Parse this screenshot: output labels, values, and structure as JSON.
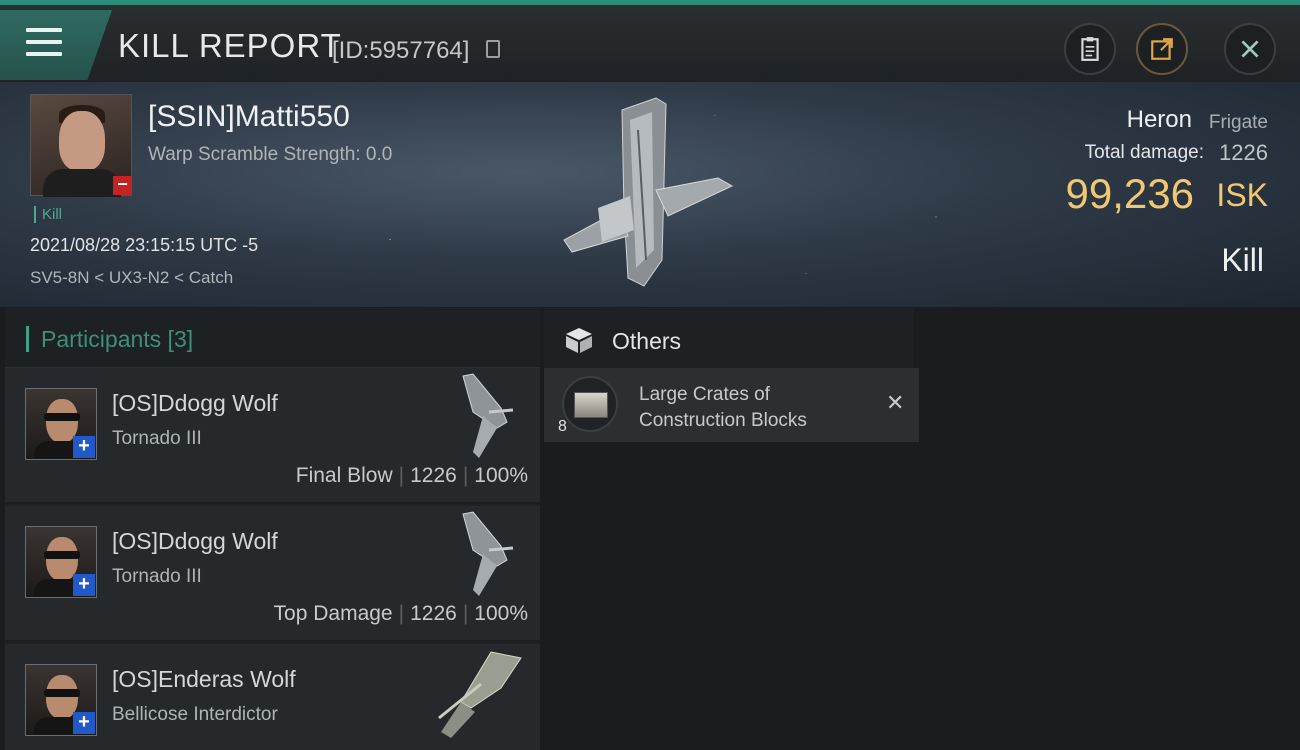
{
  "header": {
    "title": "KILL REPORT",
    "report_id": "[ID:5957764]",
    "icons": [
      "menu-icon",
      "copy-icon",
      "clipboard-icon",
      "share-icon",
      "close-icon"
    ]
  },
  "victim": {
    "name": "[SSIN]Matti550",
    "warp_scramble": "Warp Scramble Strength: 0.0",
    "tag": "Kill",
    "datetime": "2021/08/28 23:15:15 UTC -5",
    "location": "SV5-8N < UX3-N2 < Catch",
    "ship_name": "Heron",
    "ship_class": "Frigate",
    "total_damage_label": "Total damage:",
    "total_damage": "1226",
    "isk_value": "99,236",
    "isk_unit": "ISK",
    "result": "Kill"
  },
  "participants": {
    "title": "Participants [3]",
    "rows": [
      {
        "name": "[OS]Ddogg Wolf",
        "ship": "Tornado III",
        "role": "Final Blow",
        "damage": "1226",
        "percent": "100%"
      },
      {
        "name": "[OS]Ddogg Wolf",
        "ship": "Tornado III",
        "role": "Top Damage",
        "damage": "1226",
        "percent": "100%"
      },
      {
        "name": "[OS]Enderas Wolf",
        "ship": "Bellicose Interdictor",
        "role": "",
        "damage": "",
        "percent": ""
      }
    ]
  },
  "others": {
    "title": "Others",
    "items": [
      {
        "quantity": "8",
        "name": "Large Crates of Construction Blocks"
      }
    ]
  },
  "colors": {
    "accent": "#2c8c7a",
    "isk": "#f0c871",
    "minus_badge": "#c42323",
    "plus_badge": "#2159c9"
  }
}
